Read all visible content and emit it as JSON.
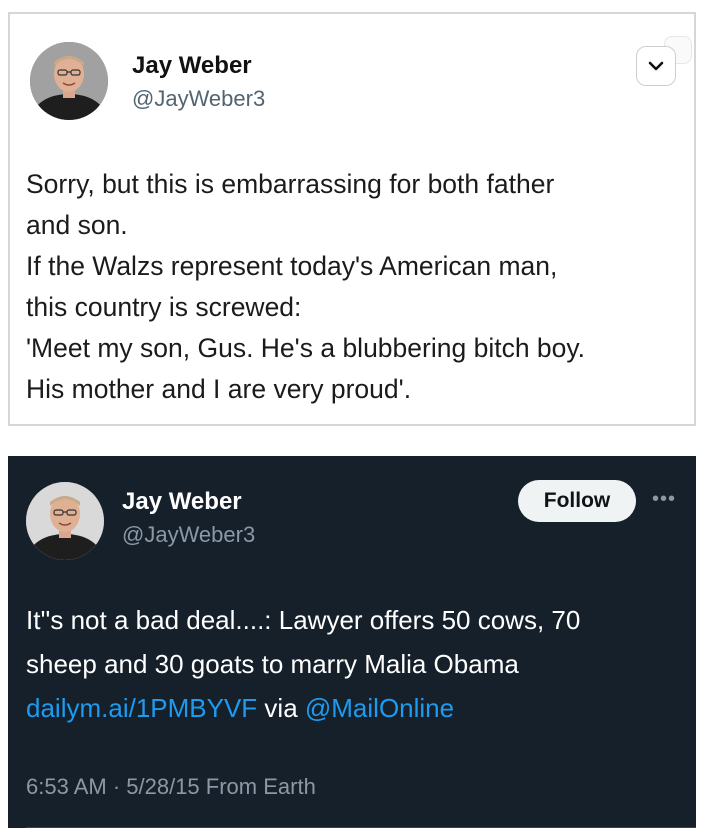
{
  "tweets": [
    {
      "theme": "light",
      "author": {
        "name": "Jay Weber",
        "handle": "@JayWeber3"
      },
      "menu_icon": "chevron-down-icon",
      "text_lines": [
        "Sorry, but this is embarrassing for both father",
        "and son.",
        "If the Walzs represent today's American man,",
        "this country is screwed:",
        "'Meet my son, Gus. He's a blubbering bitch boy.",
        "His mother and I are very proud'."
      ]
    },
    {
      "theme": "dark",
      "author": {
        "name": "Jay Weber",
        "handle": "@JayWeber3"
      },
      "follow_label": "Follow",
      "more_icon": "more-dots-icon",
      "more_glyph": "•••",
      "text_lines": [
        "It''s not a bad deal....: Lawyer offers 50 cows, 70",
        "sheep and 30 goats to marry Malia Obama"
      ],
      "link_line": {
        "url_text": "dailym.ai/1PMBYVF",
        "via_text": " via ",
        "mention_text": "@MailOnline"
      },
      "meta": "6:53 AM · 5/28/15 From Earth"
    }
  ],
  "colors": {
    "light_bg": "#ffffff",
    "dark_bg": "#15202b",
    "link_blue": "#1d9bf0",
    "muted_gray": "#536471"
  }
}
